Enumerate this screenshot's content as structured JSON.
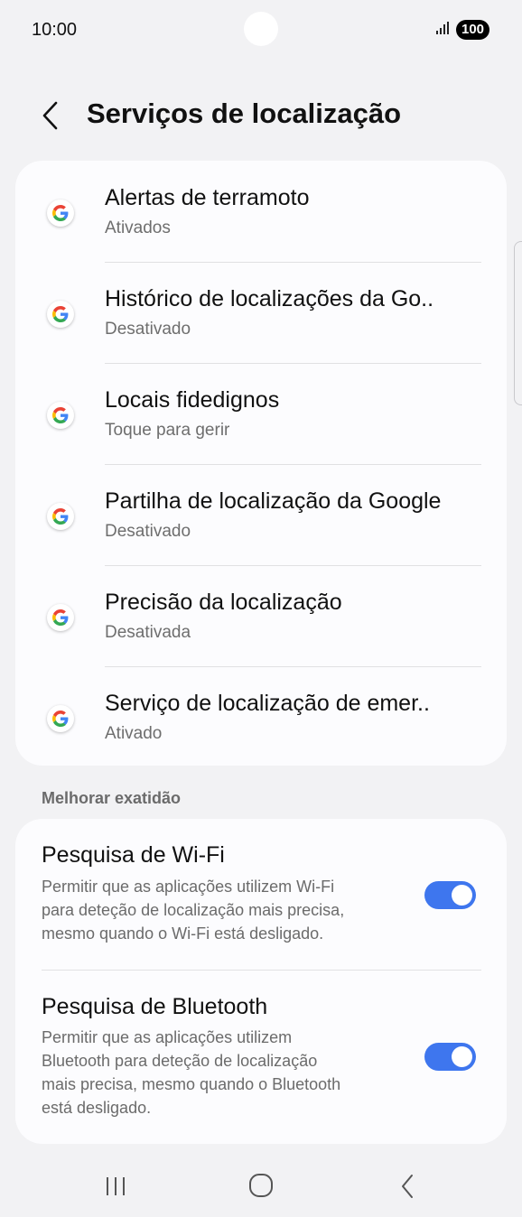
{
  "status": {
    "time": "10:00",
    "battery": "100"
  },
  "header": {
    "title": "Serviços de localização"
  },
  "services": [
    {
      "title": "Alertas de terramoto",
      "subtitle": "Ativados"
    },
    {
      "title": "Histórico de localizações da Go..",
      "subtitle": "Desativado"
    },
    {
      "title": "Locais fidedignos",
      "subtitle": "Toque para gerir"
    },
    {
      "title": "Partilha de localização da Google",
      "subtitle": "Desativado"
    },
    {
      "title": "Precisão da localização",
      "subtitle": "Desativada"
    },
    {
      "title": "Serviço de localização de emer..",
      "subtitle": "Ativado"
    }
  ],
  "section": {
    "label": "Melhorar exatidão"
  },
  "toggles": [
    {
      "title": "Pesquisa de Wi-Fi",
      "line1": "Permitir que as aplicações utilizem Wi-Fi",
      "line2": "para deteção de localização mais precisa,",
      "line3": "mesmo quando o Wi-Fi está desligado.",
      "line4": "",
      "enabled": true
    },
    {
      "title": "Pesquisa de Bluetooth",
      "line1": "Permitir que as aplicações utilizem",
      "line2": "Bluetooth para deteção de localização",
      "line3": "mais precisa, mesmo quando o Bluetooth",
      "line4": "está desligado.",
      "enabled": true
    }
  ],
  "colors": {
    "accent": "#3e76ee",
    "background": "#f2f2f4",
    "card": "#fcfcfe"
  },
  "icons": {
    "back": "back-arrow-icon",
    "google": "google-g-icon",
    "recents": "recents-icon",
    "home": "home-icon",
    "nav_back": "nav-back-icon"
  }
}
